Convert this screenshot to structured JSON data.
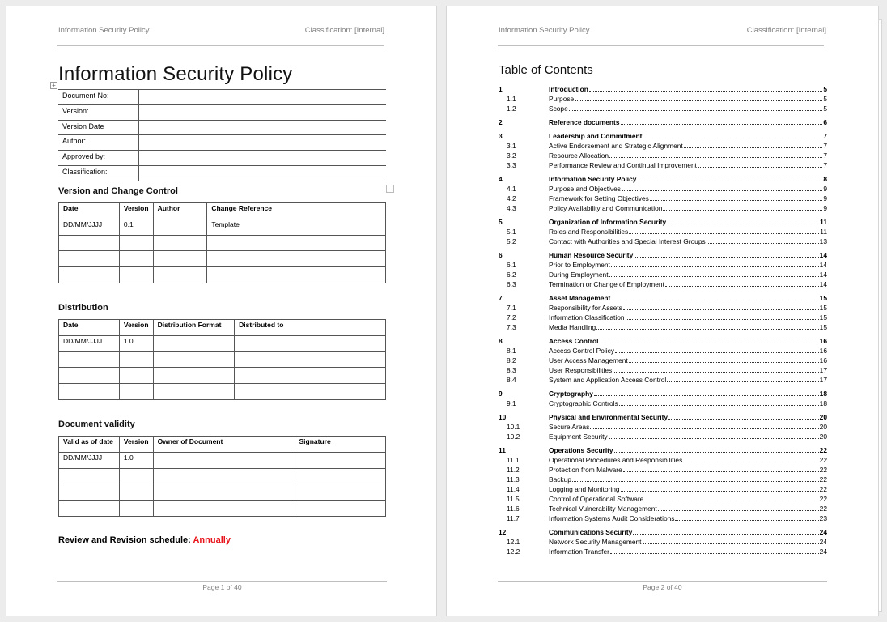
{
  "header": {
    "left": "Information Security Policy",
    "right": "Classification: [Internal]"
  },
  "page1": {
    "title": "Information Security Policy",
    "metadata_fields": [
      {
        "label": "Document No:",
        "value": ""
      },
      {
        "label": "Version:",
        "value": ""
      },
      {
        "label": "Version Date",
        "value": ""
      },
      {
        "label": "Author:",
        "value": ""
      },
      {
        "label": "Approved by:",
        "value": ""
      },
      {
        "label": "Classification:",
        "value": ""
      }
    ],
    "version_control": {
      "title": "Version and Change Control",
      "columns": [
        "Date",
        "Version",
        "Author",
        "Change Reference"
      ],
      "rows": [
        [
          "DD/MM/JJJJ",
          "0.1",
          "",
          "Template"
        ],
        [
          "",
          "",
          "",
          ""
        ],
        [
          "",
          "",
          "",
          ""
        ],
        [
          "",
          "",
          "",
          ""
        ]
      ]
    },
    "distribution": {
      "title": "Distribution",
      "columns": [
        "Date",
        "Version",
        "Distribution Format",
        "Distributed to"
      ],
      "rows": [
        [
          "DD/MM/JJJJ",
          "1.0",
          "",
          ""
        ],
        [
          "",
          "",
          "",
          ""
        ],
        [
          "",
          "",
          "",
          ""
        ],
        [
          "",
          "",
          "",
          ""
        ]
      ]
    },
    "validity": {
      "title": "Document validity",
      "columns": [
        "Valid as of date",
        "Version",
        "Owner of Document",
        "Signature"
      ],
      "rows": [
        [
          "DD/MM/JJJJ",
          "1.0",
          "",
          ""
        ],
        [
          "",
          "",
          "",
          ""
        ],
        [
          "",
          "",
          "",
          ""
        ],
        [
          "",
          "",
          "",
          ""
        ]
      ]
    },
    "review": {
      "label": "Review and Revision schedule: ",
      "value": "Annually",
      "value_color": "#e8141b"
    },
    "footer": "Page 1 of 40"
  },
  "page2": {
    "toc_title": "Table of Contents",
    "toc": [
      {
        "num": "1",
        "text": "Introduction",
        "page": "5",
        "level": 1
      },
      {
        "num": "1.1",
        "text": "Purpose",
        "page": "5",
        "level": 2
      },
      {
        "num": "1.2",
        "text": "Scope",
        "page": "5",
        "level": 2
      },
      {
        "num": "2",
        "text": "Reference documents",
        "page": "6",
        "level": 1
      },
      {
        "num": "3",
        "text": "Leadership and Commitment",
        "page": "7",
        "level": 1
      },
      {
        "num": "3.1",
        "text": "Active Endorsement and Strategic Alignment",
        "page": "7",
        "level": 2
      },
      {
        "num": "3.2",
        "text": "Resource Allocation",
        "page": "7",
        "level": 2
      },
      {
        "num": "3.3",
        "text": "Performance Review and Continual Improvement",
        "page": "7",
        "level": 2
      },
      {
        "num": "4",
        "text": "Information Security Policy",
        "page": "8",
        "level": 1
      },
      {
        "num": "4.1",
        "text": "Purpose and Objectives",
        "page": "9",
        "level": 2
      },
      {
        "num": "4.2",
        "text": "Framework for Setting Objectives",
        "page": "9",
        "level": 2
      },
      {
        "num": "4.3",
        "text": "Policy Availability and Communication",
        "page": "9",
        "level": 2
      },
      {
        "num": "5",
        "text": "Organization of Information Security",
        "page": "11",
        "level": 1
      },
      {
        "num": "5.1",
        "text": "Roles and Responsibilities",
        "page": "11",
        "level": 2
      },
      {
        "num": "5.2",
        "text": "Contact with Authorities and Special Interest Groups",
        "page": "13",
        "level": 2
      },
      {
        "num": "6",
        "text": "Human Resource Security",
        "page": "14",
        "level": 1
      },
      {
        "num": "6.1",
        "text": "Prior to Employment",
        "page": "14",
        "level": 2
      },
      {
        "num": "6.2",
        "text": "During Employment",
        "page": "14",
        "level": 2
      },
      {
        "num": "6.3",
        "text": "Termination or Change of Employment",
        "page": "14",
        "level": 2
      },
      {
        "num": "7",
        "text": "Asset Management",
        "page": "15",
        "level": 1
      },
      {
        "num": "7.1",
        "text": "Responsibility for Assets",
        "page": "15",
        "level": 2
      },
      {
        "num": "7.2",
        "text": "Information Classification",
        "page": "15",
        "level": 2
      },
      {
        "num": "7.3",
        "text": "Media Handling",
        "page": "15",
        "level": 2
      },
      {
        "num": "8",
        "text": "Access Control",
        "page": "16",
        "level": 1
      },
      {
        "num": "8.1",
        "text": "Access Control Policy",
        "page": "16",
        "level": 2
      },
      {
        "num": "8.2",
        "text": "User Access Management",
        "page": "16",
        "level": 2
      },
      {
        "num": "8.3",
        "text": "User Responsibilities",
        "page": "17",
        "level": 2
      },
      {
        "num": "8.4",
        "text": "System and Application Access Control",
        "page": "17",
        "level": 2
      },
      {
        "num": "9",
        "text": "Cryptography",
        "page": "18",
        "level": 1
      },
      {
        "num": "9.1",
        "text": "Cryptographic Controls",
        "page": "18",
        "level": 2
      },
      {
        "num": "10",
        "text": "Physical and Environmental Security",
        "page": "20",
        "level": 1
      },
      {
        "num": "10.1",
        "text": "Secure Areas",
        "page": "20",
        "level": 2
      },
      {
        "num": "10.2",
        "text": "Equipment Security",
        "page": "20",
        "level": 2
      },
      {
        "num": "11",
        "text": "Operations Security",
        "page": "22",
        "level": 1
      },
      {
        "num": "11.1",
        "text": "Operational Procedures and Responsibilities",
        "page": "22",
        "level": 2
      },
      {
        "num": "11.2",
        "text": "Protection from Malware",
        "page": "22",
        "level": 2
      },
      {
        "num": "11.3",
        "text": "Backup",
        "page": "22",
        "level": 2
      },
      {
        "num": "11.4",
        "text": "Logging and Monitoring",
        "page": "22",
        "level": 2
      },
      {
        "num": "11.5",
        "text": "Control of Operational Software",
        "page": "22",
        "level": 2
      },
      {
        "num": "11.6",
        "text": "Technical Vulnerability Management",
        "page": "22",
        "level": 2
      },
      {
        "num": "11.7",
        "text": "Information Systems Audit Considerations",
        "page": "23",
        "level": 2
      },
      {
        "num": "12",
        "text": "Communications Security",
        "page": "24",
        "level": 1
      },
      {
        "num": "12.1",
        "text": "Network Security Management",
        "page": "24",
        "level": 2
      },
      {
        "num": "12.2",
        "text": "Information Transfer",
        "page": "24",
        "level": 2
      }
    ],
    "footer": "Page 2 of 40"
  }
}
